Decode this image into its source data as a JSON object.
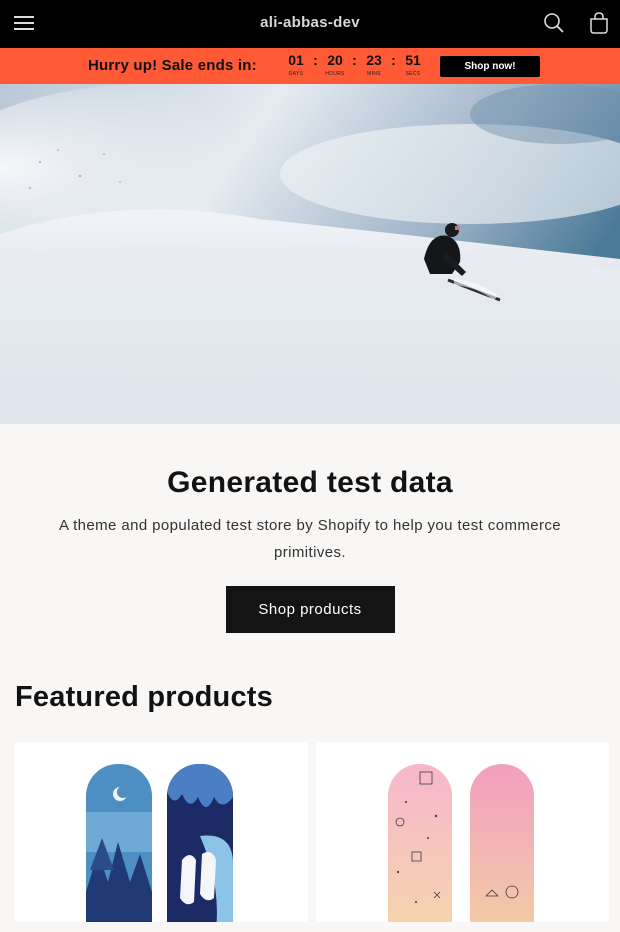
{
  "header": {
    "store_name": "ali-abbas-dev",
    "menu_icon": "hamburger-menu-icon",
    "search_icon": "search-icon",
    "cart_icon": "cart-icon"
  },
  "countdown": {
    "text": "Hurry up! Sale ends in:",
    "units": [
      {
        "value": "01",
        "label": "DAYS"
      },
      {
        "value": "20",
        "label": "HOURS"
      },
      {
        "value": "23",
        "label": "MINS"
      },
      {
        "value": "51",
        "label": "SECS"
      }
    ],
    "separator": ":",
    "button_label": "Shop now!",
    "background_color": "#ff5a35"
  },
  "intro": {
    "title": "Generated test data",
    "text": "A theme and populated test store by Shopify to help you test commerce primitives.",
    "button_label": "Shop products"
  },
  "featured": {
    "title": "Featured products",
    "products": [
      {
        "image": "snowboard-pair-blue-image"
      },
      {
        "image": "snowboard-pair-pink-image"
      }
    ]
  }
}
